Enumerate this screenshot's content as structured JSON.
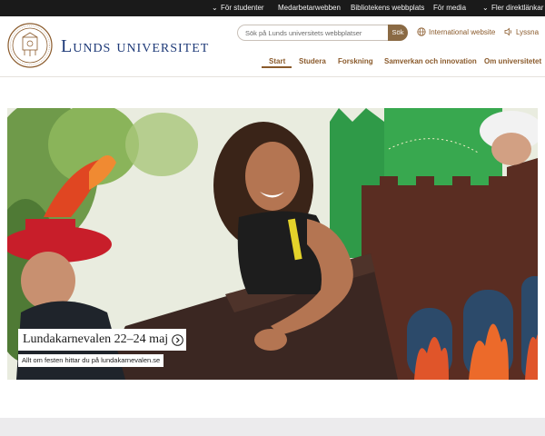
{
  "topbar": {
    "links": [
      {
        "label": "För studenter",
        "has_chevron": true
      },
      {
        "label": "Medarbetarwebben",
        "has_chevron": false
      },
      {
        "label": "Bibliotekens webbplats",
        "has_chevron": false
      },
      {
        "label": "För media",
        "has_chevron": false
      },
      {
        "label": "Fler direktlänkar",
        "has_chevron": true
      }
    ]
  },
  "header": {
    "logo_icon": "university-seal-icon",
    "wordmark": "Lunds universitet",
    "search": {
      "placeholder": "Sök på Lunds universitets webbplatser",
      "button_label": "Sök"
    },
    "utility": {
      "international": "International website",
      "international_icon": "globe-icon",
      "listen": "Lyssna",
      "listen_icon": "speaker-icon"
    },
    "nav": [
      {
        "label": "Start",
        "active": true
      },
      {
        "label": "Studera",
        "active": false
      },
      {
        "label": "Forskning",
        "active": false
      },
      {
        "label": "Samverkan och innovation",
        "active": false
      },
      {
        "label": "Om universitetet",
        "active": false
      }
    ]
  },
  "hero": {
    "title": "Lundakarnevalen 22–24 maj",
    "arrow_icon": "arrow-right-circle-icon",
    "subtitle": "Allt om festen hittar du på lundakarnevalen.se"
  },
  "colors": {
    "brand_blue": "#1e3a78",
    "bronze": "#8a5a2b",
    "search_button": "#8a6a44",
    "topbar": "#1a1a1a"
  }
}
